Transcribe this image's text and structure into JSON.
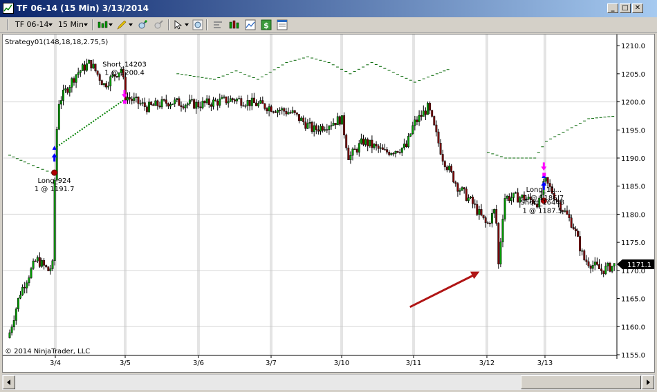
{
  "window": {
    "title": "TF 06-14 (15 Min)  3/13/2014",
    "controls": [
      "minimize-icon",
      "maximize-icon",
      "close-icon"
    ]
  },
  "toolbar": {
    "instrument": "TF 06-14",
    "interval": "15 Min",
    "icons": [
      "candlestick-icon",
      "pencil-icon",
      "zoom-in-icon",
      "zoom-out-icon",
      "cursor-icon",
      "magnify-icon",
      "indicator-icon",
      "strategy-icon",
      "chart-icon",
      "dollar-icon",
      "properties-icon"
    ]
  },
  "chart": {
    "strategy_label": "Strategy01(148,18,18,2.75,5)",
    "copyright": "© 2014 NinjaTrader, LLC",
    "current_price": "1171.1",
    "colors": {
      "up": "#00a000",
      "down": "#800000",
      "wick": "#000000",
      "stop_line": "#006400",
      "arrow": "#b01515",
      "buy_arrow": "#0000ff",
      "sell_arrow": "#ff00ff"
    }
  },
  "chart_data": {
    "type": "candlestick",
    "ylim": [
      1155,
      1211
    ],
    "y_ticks": [
      "1210.0",
      "1205.0",
      "1200.0",
      "1195.0",
      "1190.0",
      "1185.0",
      "1180.0",
      "1175.0",
      "1170.0",
      "1165.0",
      "1160.0",
      "1155.0"
    ],
    "x_ticks": [
      "3/4",
      "3/5",
      "3/6",
      "3/7",
      "3/10",
      "3/11",
      "3/12",
      "3/13"
    ],
    "price_path": [
      [
        0,
        1158
      ],
      [
        0.25,
        1166
      ],
      [
        0.6,
        1172
      ],
      [
        0.85,
        1170
      ],
      [
        0.95,
        1171
      ],
      [
        1.0,
        1191.5
      ],
      [
        1.05,
        1200
      ],
      [
        1.3,
        1205
      ],
      [
        1.5,
        1207
      ],
      [
        1.7,
        1203
      ],
      [
        1.95,
        1206
      ],
      [
        2.0,
        1201
      ],
      [
        2.3,
        1199
      ],
      [
        2.6,
        1200
      ],
      [
        3.0,
        1199.5
      ],
      [
        3.5,
        1200.5
      ],
      [
        4.0,
        1199
      ],
      [
        4.3,
        1198
      ],
      [
        4.6,
        1195
      ],
      [
        5.0,
        1197
      ],
      [
        5.1,
        1190
      ],
      [
        5.3,
        1193
      ],
      [
        5.6,
        1191
      ],
      [
        5.9,
        1192
      ],
      [
        6.0,
        1196
      ],
      [
        6.2,
        1199
      ],
      [
        6.4,
        1190
      ],
      [
        6.6,
        1185
      ],
      [
        6.8,
        1182
      ],
      [
        7.0,
        1178
      ],
      [
        7.15,
        1181
      ],
      [
        7.2,
        1171
      ],
      [
        7.3,
        1183
      ],
      [
        7.6,
        1183
      ],
      [
        7.9,
        1182
      ],
      [
        8.0,
        1186
      ],
      [
        8.15,
        1183
      ],
      [
        8.4,
        1178
      ],
      [
        8.55,
        1172
      ],
      [
        8.8,
        1170
      ],
      [
        9.0,
        1171
      ]
    ],
    "stop_levels": [
      {
        "x_from": 0,
        "x_to": 1,
        "points": [
          [
            0,
            1190.5
          ],
          [
            0.4,
            1189
          ],
          [
            0.7,
            1188
          ],
          [
            1.0,
            1187
          ]
        ]
      },
      {
        "x_from": 2.7,
        "x_to": 6.5,
        "points": [
          [
            2.7,
            1205
          ],
          [
            3.2,
            1204
          ],
          [
            3.5,
            1205.5
          ],
          [
            3.8,
            1204
          ],
          [
            4.2,
            1207
          ],
          [
            4.5,
            1208
          ],
          [
            4.8,
            1207
          ],
          [
            5.1,
            1205
          ],
          [
            5.4,
            1207
          ],
          [
            6.0,
            1203.5
          ],
          [
            6.3,
            1205
          ],
          [
            6.5,
            1206
          ]
        ]
      },
      {
        "x_from": 7.0,
        "x_to": 9.0,
        "points": [
          [
            7.0,
            1191
          ],
          [
            7.3,
            1190
          ],
          [
            7.8,
            1190
          ],
          [
            8.0,
            1193
          ],
          [
            8.3,
            1195
          ],
          [
            8.6,
            1197
          ],
          [
            9.0,
            1197.5
          ]
        ]
      }
    ],
    "trades": [
      {
        "x": 0.98,
        "y": 1191.7,
        "label": "Long_924",
        "qty_price": "1 @ 1191.7",
        "side": "long"
      },
      {
        "x": 1.99,
        "y": 1200.4,
        "label": "Short_14203",
        "qty_price": "1 @ 1200.4",
        "side": "short"
      },
      {
        "x": 7.98,
        "y": 1186.7,
        "label": "Long_11...",
        "qty_price": "1 @ 1186.7",
        "side": "long"
      },
      {
        "x": 7.98,
        "y": 1187.5,
        "label": "Short_16448",
        "qty_price": "1 @ 1187.5",
        "side": "short"
      }
    ],
    "annotation_arrow": {
      "from": [
        5.95,
        1163.5
      ],
      "to": [
        6.9,
        1169.8
      ]
    }
  }
}
